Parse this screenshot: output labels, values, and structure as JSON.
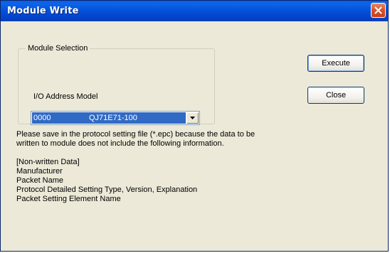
{
  "window": {
    "title": "Module Write",
    "close_icon": "close-icon"
  },
  "module_selection": {
    "group_label": "Module Selection",
    "field_label": "I/O Address Model",
    "selected": {
      "address": "0000",
      "model": "QJ71E71-100"
    },
    "dropdown_icon": "chevron-down-icon"
  },
  "buttons": {
    "execute": "Execute",
    "close": "Close"
  },
  "message": {
    "line1": "Please save in the protocol setting file (*.epc) because the data to be",
    "line2": "written to module does not include the following information.",
    "items": [
      "[Non-written Data]",
      "Manufacturer",
      "Packet Name",
      "Protocol Detailed Setting Type, Version, Explanation",
      "Packet Setting Element Name"
    ]
  },
  "colors": {
    "titlebar": "#0550d8",
    "selection": "#316ac5",
    "dialog_bg": "#ece9d8",
    "close_button": "#d9552d"
  }
}
